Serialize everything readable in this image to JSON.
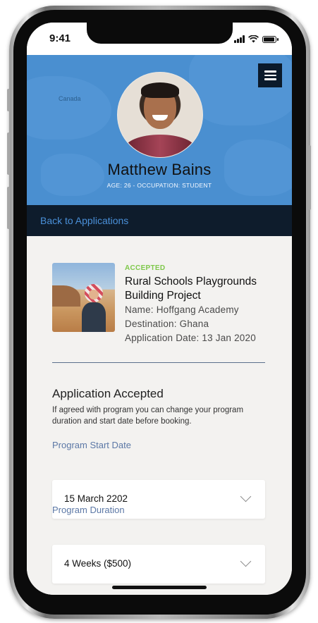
{
  "status_bar": {
    "time": "9:41"
  },
  "header": {
    "map_label": "Canada",
    "name": "Matthew Bains",
    "subtitle": "AGE: 26 - OCCUPATION: STUDENT"
  },
  "nav": {
    "back_label": "Back to Applications"
  },
  "application": {
    "status": "ACCEPTED",
    "title": "Rural Schools Playgrounds Building Project",
    "name_line": "Name: Hoffgang Academy",
    "destination_line": "Destination: Ghana",
    "date_line": "Application Date: 13 Jan 2020"
  },
  "acceptance": {
    "title": "Application Accepted",
    "description": "If agreed with program you can change your program duration and start date before booking.",
    "start_date": {
      "label": "Program Start Date",
      "value": "15 March 2202"
    },
    "duration": {
      "label": "Program Duration",
      "value": "4 Weeks ($500)"
    }
  },
  "colors": {
    "header_blue": "#4a8fd0",
    "nav_dark": "#0e1c2c",
    "link_blue": "#4a90d9",
    "accepted_green": "#7ec84a",
    "label_blue": "#5c78a6"
  },
  "icons": [
    "menu-icon",
    "chevron-down-icon",
    "signal-icon",
    "wifi-icon",
    "battery-icon"
  ]
}
